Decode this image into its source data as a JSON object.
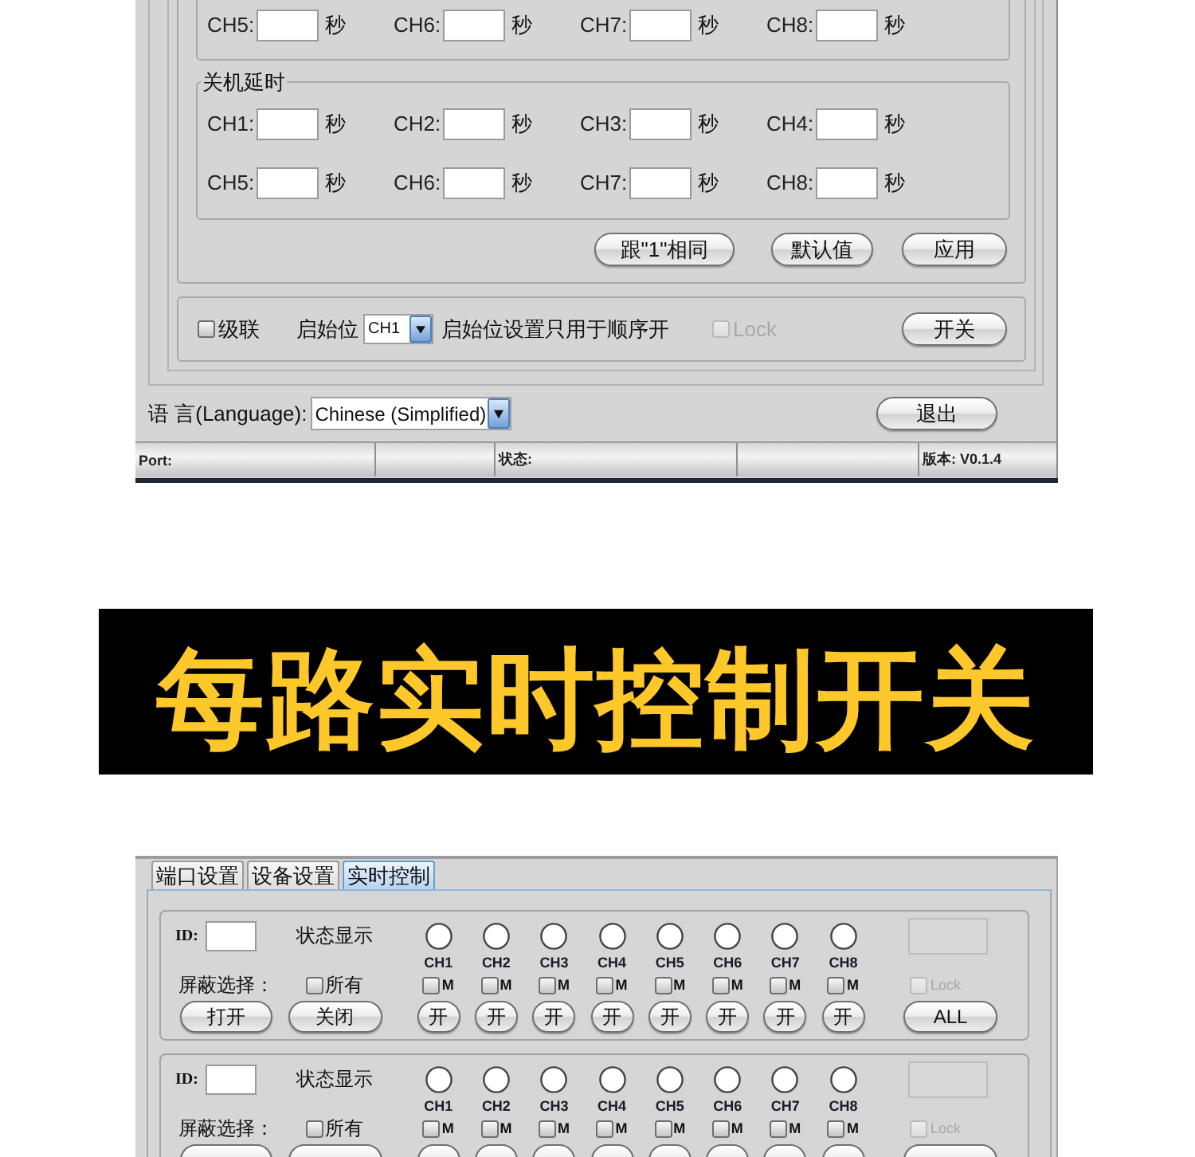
{
  "config_window": {
    "upper_group": {
      "rows": [
        [
          {
            "label": "CH5:",
            "unit": "秒"
          },
          {
            "label": "CH6:",
            "unit": "秒"
          },
          {
            "label": "CH7:",
            "unit": "秒"
          },
          {
            "label": "CH8:",
            "unit": "秒"
          }
        ]
      ]
    },
    "shutdown_delay": {
      "title": "关机延时",
      "rows": [
        [
          {
            "label": "CH1:",
            "unit": "秒"
          },
          {
            "label": "CH2:",
            "unit": "秒"
          },
          {
            "label": "CH3:",
            "unit": "秒"
          },
          {
            "label": "CH4:",
            "unit": "秒"
          }
        ],
        [
          {
            "label": "CH5:",
            "unit": "秒"
          },
          {
            "label": "CH6:",
            "unit": "秒"
          },
          {
            "label": "CH7:",
            "unit": "秒"
          },
          {
            "label": "CH8:",
            "unit": "秒"
          }
        ]
      ]
    },
    "group_buttons": [
      "跟\"1\"相同",
      "默认值",
      "应用"
    ],
    "sequence_bar": {
      "cascade": {
        "label": "级联",
        "checked": false
      },
      "start_label": "启始位",
      "start_select": "CH1",
      "note": "启始位设置只用于顺序开",
      "lock": {
        "label": "Lock",
        "checked": false,
        "disabled": true
      },
      "button": "开关"
    },
    "language": {
      "label": "语 言(Language):",
      "value": "Chinese (Simplified)"
    },
    "exit_button": "退出",
    "status_bar": {
      "port": "Port:",
      "status": "状态:",
      "version": "版本: V0.1.4"
    }
  },
  "banner": {
    "title": "每路实时控制开关"
  },
  "control_window": {
    "tabs": [
      {
        "label": "端口设置",
        "selected": false
      },
      {
        "label": "设备设置",
        "selected": false
      },
      {
        "label": "实时控制",
        "selected": true
      }
    ],
    "groups": [
      {
        "id_label": "ID:",
        "status_label": "状态显示",
        "mask_label": "屏蔽选择：",
        "select_all": {
          "label": "所有",
          "checked": false
        },
        "channels": [
          {
            "name": "CH1",
            "lit": false,
            "mask": {
              "label": "M",
              "checked": false
            },
            "button": "开"
          },
          {
            "name": "CH2",
            "lit": false,
            "mask": {
              "label": "M",
              "checked": false
            },
            "button": "开"
          },
          {
            "name": "CH3",
            "lit": false,
            "mask": {
              "label": "M",
              "checked": false
            },
            "button": "开"
          },
          {
            "name": "CH4",
            "lit": false,
            "mask": {
              "label": "M",
              "checked": false
            },
            "button": "开"
          },
          {
            "name": "CH5",
            "lit": false,
            "mask": {
              "label": "M",
              "checked": false
            },
            "button": "开"
          },
          {
            "name": "CH6",
            "lit": false,
            "mask": {
              "label": "M",
              "checked": false
            },
            "button": "开"
          },
          {
            "name": "CH7",
            "lit": false,
            "mask": {
              "label": "M",
              "checked": false
            },
            "button": "开"
          },
          {
            "name": "CH8",
            "lit": false,
            "mask": {
              "label": "M",
              "checked": false
            },
            "button": "开"
          }
        ],
        "lock": {
          "label": "Lock",
          "checked": false,
          "disabled": true
        },
        "buttons": {
          "open": "打开",
          "close": "关闭",
          "all": "ALL"
        }
      },
      {
        "id_label": "ID:",
        "status_label": "状态显示",
        "mask_label": "屏蔽选择：",
        "select_all": {
          "label": "所有",
          "checked": false
        },
        "channels": [
          {
            "name": "CH1",
            "lit": false,
            "mask": {
              "label": "M",
              "checked": false
            }
          },
          {
            "name": "CH2",
            "lit": false,
            "mask": {
              "label": "M",
              "checked": false
            }
          },
          {
            "name": "CH3",
            "lit": false,
            "mask": {
              "label": "M",
              "checked": false
            }
          },
          {
            "name": "CH4",
            "lit": false,
            "mask": {
              "label": "M",
              "checked": false
            }
          },
          {
            "name": "CH5",
            "lit": false,
            "mask": {
              "label": "M",
              "checked": false
            }
          },
          {
            "name": "CH6",
            "lit": false,
            "mask": {
              "label": "M",
              "checked": false
            }
          },
          {
            "name": "CH7",
            "lit": false,
            "mask": {
              "label": "M",
              "checked": false
            }
          },
          {
            "name": "CH8",
            "lit": false,
            "mask": {
              "label": "M",
              "checked": false
            }
          }
        ],
        "lock": {
          "label": "Lock",
          "checked": false,
          "disabled": true
        }
      }
    ]
  }
}
